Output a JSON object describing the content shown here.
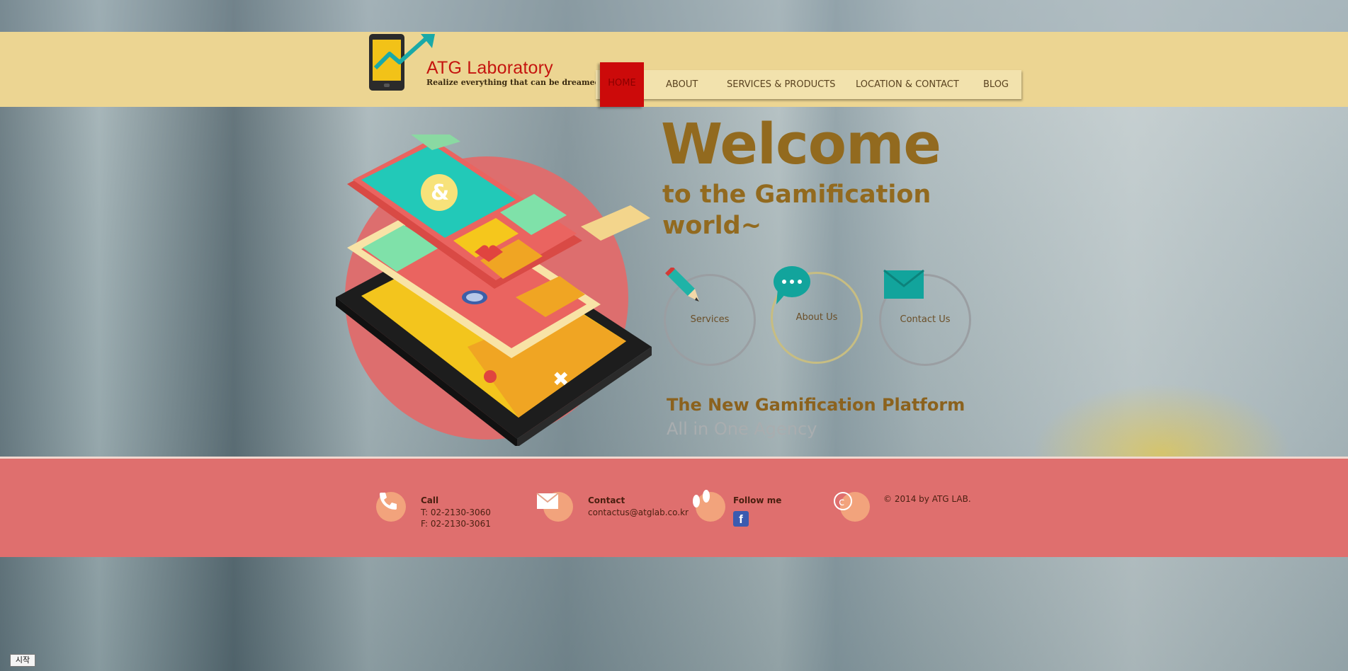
{
  "header": {
    "brand_name": "ATG Laboratory",
    "tagline": "Realize everything that can be dreamed"
  },
  "nav": {
    "items": [
      {
        "label": "HOME",
        "active": true
      },
      {
        "label": "ABOUT"
      },
      {
        "label": "SERVICES & PRODUCTS"
      },
      {
        "label": "LOCATION & CONTACT"
      },
      {
        "label": "BLOG"
      }
    ]
  },
  "hero": {
    "welcome": "Welcome",
    "subtitle": "to the Gamification world~",
    "circles": [
      {
        "label": "Services",
        "icon": "pencil-icon"
      },
      {
        "label": "About Us",
        "icon": "speech-bubble-icon"
      },
      {
        "label": "Contact Us",
        "icon": "envelope-icon"
      }
    ],
    "platform_title": "The New Gamification Platform",
    "platform_sub": "All in One Agency"
  },
  "footer": {
    "call_title": "Call",
    "call_tel": "T: 02-2130-3060",
    "call_fax": "F: 02-2130-3061",
    "contact_title": "Contact",
    "contact_email": "contactus@atglab.co.kr",
    "follow_title": "Follow me",
    "copyright": "© 2014 by ATG LAB."
  },
  "taskbar": {
    "start_label": "시작"
  },
  "colors": {
    "header_bg": "#ecd592",
    "accent_red": "#cc0a0a",
    "footer_bg": "#df6f6e",
    "heading_gold": "#926a1f"
  }
}
